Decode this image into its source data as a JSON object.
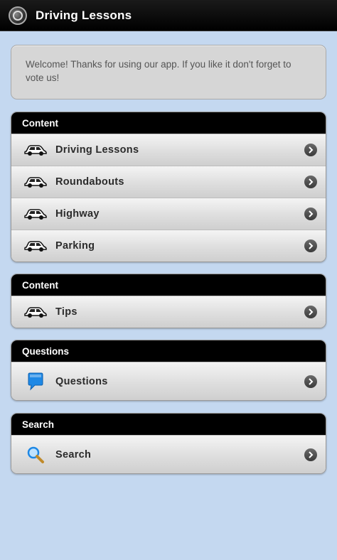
{
  "app": {
    "title": "Driving Lessons"
  },
  "welcome": {
    "text": "Welcome! Thanks for using our app. If you like it don't forget to vote us!"
  },
  "groups": [
    {
      "header": "Content",
      "items": [
        {
          "label": "Driving Lessons",
          "icon": "car-icon"
        },
        {
          "label": "Roundabouts",
          "icon": "car-icon"
        },
        {
          "label": "Highway",
          "icon": "car-icon"
        },
        {
          "label": "Parking",
          "icon": "car-icon"
        }
      ]
    },
    {
      "header": "Content",
      "items": [
        {
          "label": "Tips",
          "icon": "car-icon"
        }
      ]
    },
    {
      "header": "Questions",
      "items": [
        {
          "label": "Questions",
          "icon": "speech-bubble-icon"
        }
      ]
    },
    {
      "header": "Search",
      "items": [
        {
          "label": "Search",
          "icon": "search-icon"
        }
      ]
    }
  ],
  "colors": {
    "background": "#c4d8f0",
    "header": "#000000",
    "accent": "#1e88e5"
  }
}
